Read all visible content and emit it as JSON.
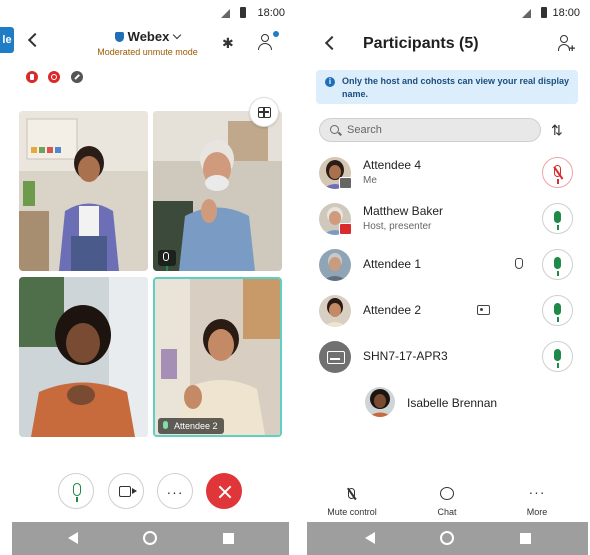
{
  "status_bar": {
    "time": "18:00"
  },
  "meeting": {
    "side_tab_label": "le",
    "app_title": "Webex",
    "mode_label": "Moderated unmute mode",
    "tiles": [
      {
        "name": ""
      },
      {
        "name": ""
      },
      {
        "name": ""
      },
      {
        "name": "Attendee 2"
      }
    ],
    "controls": {
      "more_label": "···"
    }
  },
  "participants": {
    "title": "Participants (5)",
    "info": "Only the host and cohosts can view your real display name.",
    "search_placeholder": "Search",
    "list": [
      {
        "name": "Attendee 4",
        "role": "Me",
        "mic": "muted"
      },
      {
        "name": "Matthew Baker",
        "role": "Host, presenter",
        "mic": "on"
      },
      {
        "name": "Attendee 1",
        "role": "",
        "mic": "on"
      },
      {
        "name": "Attendee 2",
        "role": "",
        "mic": "on"
      },
      {
        "name": "SHN7-17-APR3",
        "role": "",
        "mic": "on"
      }
    ],
    "lobby": {
      "name": "Isabelle Brennan"
    },
    "bottom_actions": [
      {
        "label": "Mute control"
      },
      {
        "label": "Chat"
      },
      {
        "label": "More"
      }
    ]
  },
  "colors": {
    "accent": "#1f7dc6",
    "leave": "#e0363a",
    "mic_on": "#1d8a4a",
    "mic_off": "#d92b2b",
    "active_speaker": "#5ecfc0"
  }
}
